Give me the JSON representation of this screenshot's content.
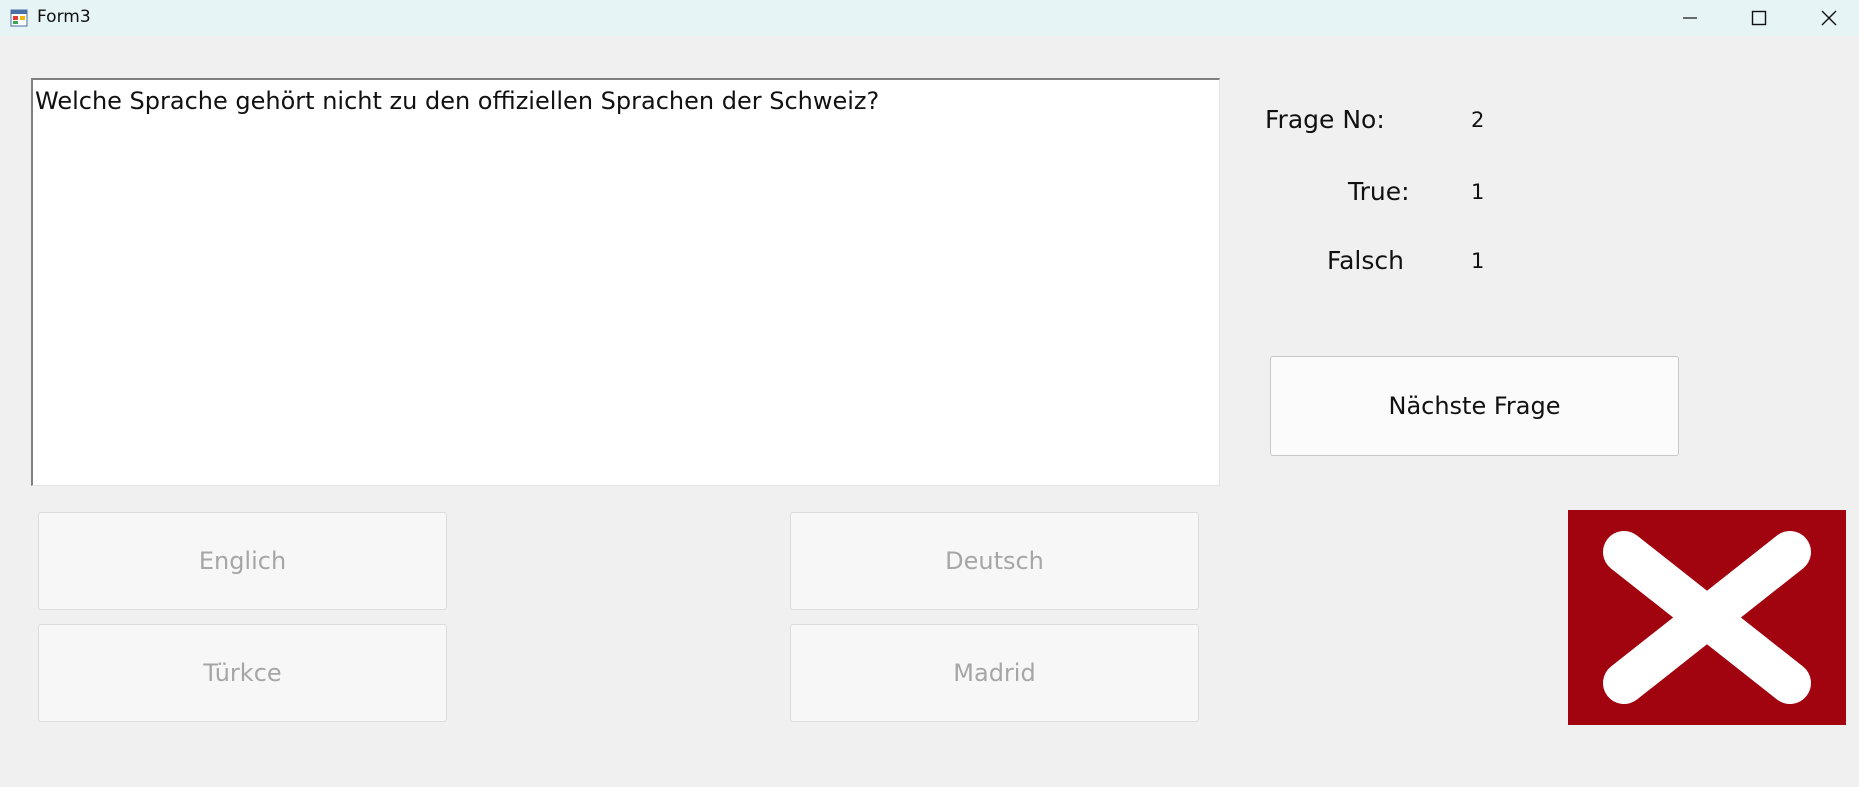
{
  "window": {
    "title": "Form3",
    "controls": {
      "minimize_icon": "minimize-icon",
      "maximize_icon": "maximize-icon",
      "close_icon": "close-icon"
    }
  },
  "question": {
    "text": "Welche Sprache gehört nicht zu den offiziellen Sprachen der Schweiz?"
  },
  "stats": {
    "question_no_label": "Frage No:",
    "question_no_value": "2",
    "true_label": "True:",
    "true_value": "1",
    "false_label": "Falsch",
    "false_value": "1"
  },
  "next_button_label": "Nächste Frage",
  "answers": [
    {
      "label": "Englich"
    },
    {
      "label": "Deutsch"
    },
    {
      "label": "Türkce"
    },
    {
      "label": "Madrid"
    }
  ],
  "result": {
    "icon": "wrong-x-icon",
    "background": "#a1040e",
    "mark_color": "#ffffff"
  }
}
